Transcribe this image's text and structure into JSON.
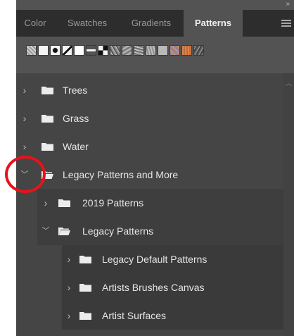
{
  "panel": {
    "close_glyph": "»",
    "tabs": [
      {
        "label": "Color",
        "active": false
      },
      {
        "label": "Swatches",
        "active": false
      },
      {
        "label": "Gradients",
        "active": false
      },
      {
        "label": "Patterns",
        "active": true
      }
    ],
    "menu_icon": "hamburger-icon"
  },
  "swatches": [
    {
      "name": "pattern-swatch-1"
    },
    {
      "name": "pattern-swatch-2"
    },
    {
      "name": "pattern-swatch-3"
    },
    {
      "name": "pattern-swatch-4"
    },
    {
      "name": "pattern-swatch-5"
    },
    {
      "name": "pattern-swatch-6"
    },
    {
      "name": "pattern-swatch-7"
    },
    {
      "name": "pattern-swatch-8"
    },
    {
      "name": "pattern-swatch-9"
    },
    {
      "name": "pattern-swatch-10"
    },
    {
      "name": "pattern-swatch-11"
    },
    {
      "name": "pattern-swatch-12"
    },
    {
      "name": "pattern-swatch-13"
    },
    {
      "name": "pattern-swatch-14"
    },
    {
      "name": "pattern-swatch-15"
    }
  ],
  "tree": {
    "items": [
      {
        "label": "Trees",
        "expanded": false
      },
      {
        "label": "Grass",
        "expanded": false
      },
      {
        "label": "Water",
        "expanded": false
      },
      {
        "label": "Legacy Patterns and More",
        "expanded": true
      },
      {
        "label": "2019 Patterns",
        "expanded": false
      },
      {
        "label": "Legacy Patterns",
        "expanded": true
      },
      {
        "label": "Legacy Default Patterns",
        "expanded": false
      },
      {
        "label": "Artists Brushes Canvas",
        "expanded": false
      },
      {
        "label": "Artist Surfaces",
        "expanded": false
      }
    ]
  },
  "colors": {
    "panel_bg": "#535353",
    "tab_bar_bg": "#2d2d2d",
    "tree_bg": "#454545",
    "highlight": "#e8121a"
  }
}
